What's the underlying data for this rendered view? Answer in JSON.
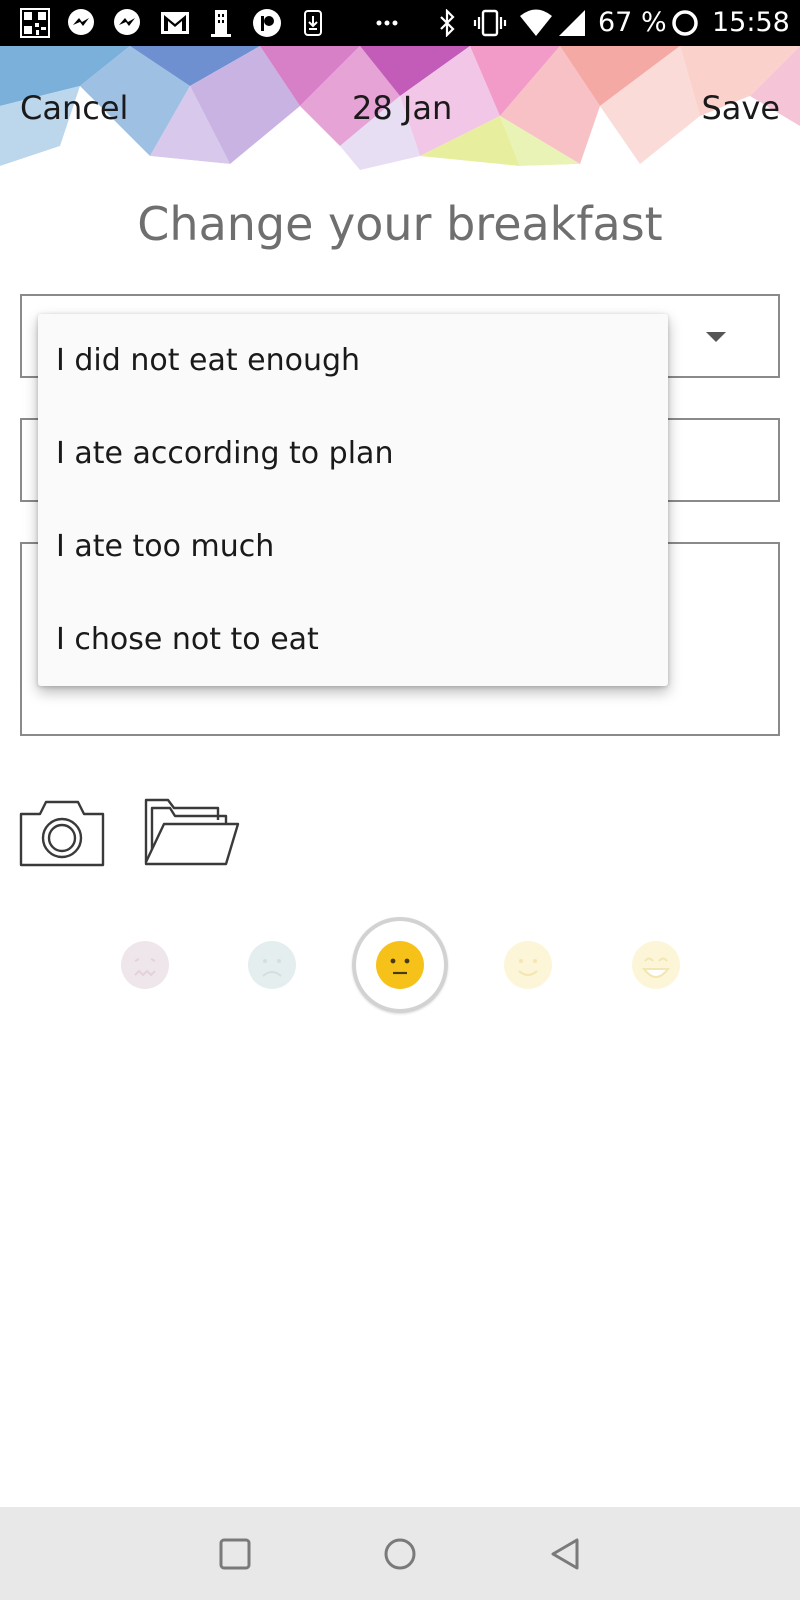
{
  "status_bar": {
    "battery_percent": "67 %",
    "time": "15:58",
    "icons": [
      "qr-code-icon",
      "messenger-icon",
      "messenger-icon",
      "gmail-icon",
      "building-icon",
      "patreon-icon",
      "download-icon",
      "more-dots-icon",
      "bluetooth-icon",
      "vibrate-icon",
      "wifi-icon",
      "signal-icon",
      "battery-ring-icon"
    ]
  },
  "header": {
    "cancel_label": "Cancel",
    "date": "28 Jan",
    "save_label": "Save"
  },
  "page": {
    "title": "Change your breakfast"
  },
  "dropdown": {
    "options": [
      {
        "label": "I did not eat enough"
      },
      {
        "label": "I ate according to plan"
      },
      {
        "label": "I ate too much"
      },
      {
        "label": "I chose not to eat"
      }
    ]
  },
  "media": {
    "icons": [
      "camera-icon",
      "folder-icon"
    ]
  },
  "mood": {
    "selected_index": 2,
    "options": [
      "sick-face-icon",
      "sad-face-icon",
      "neutral-face-icon",
      "smile-face-icon",
      "grin-face-icon"
    ],
    "colors": {
      "selected": "#f6c21a",
      "faded_sick": "#ece4ea",
      "faded_sad": "#e4ecee",
      "faded_happy": "#fbf4d6"
    }
  },
  "nav_bar": {
    "icons": [
      "recents-square-icon",
      "home-circle-icon",
      "back-triangle-icon"
    ]
  }
}
